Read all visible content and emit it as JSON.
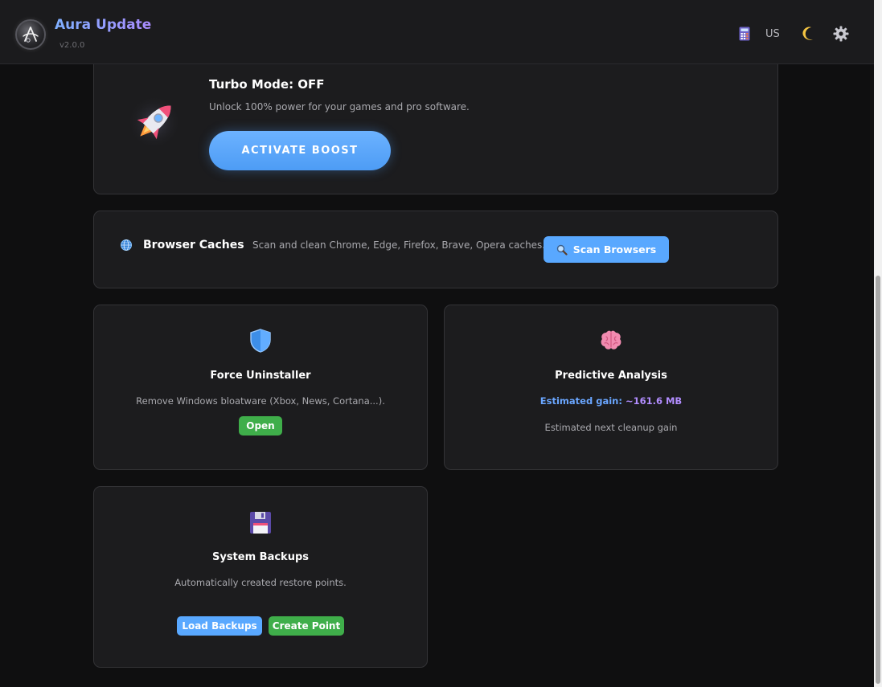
{
  "header": {
    "title": "Aura Update",
    "version": "v2.0.0",
    "language": "US",
    "icons": [
      "calculator-icon",
      "moon-icon",
      "gear-icon"
    ]
  },
  "turbo": {
    "title": "Turbo Mode: OFF",
    "description": "Unlock 100% power for your games and pro software.",
    "button_label": "ACTIVATE BOOST",
    "icon": "rocket-icon"
  },
  "browser": {
    "title": "Browser Caches",
    "description": "Scan and clean Chrome, Edge, Firefox, Brave, Opera caches.",
    "button_label": "Scan Browsers",
    "icon": "globe-icon"
  },
  "force": {
    "title": "Force Uninstaller",
    "description": "Remove Windows bloatware (Xbox, News, Cortana...).",
    "button_label": "Open",
    "icon": "shield-icon"
  },
  "predict": {
    "title": "Predictive Analysis",
    "gain_label": "Estimated gain:",
    "gain_value": "~161.6 MB",
    "subtitle": "Estimated next cleanup gain",
    "icon": "brain-icon"
  },
  "backup": {
    "title": "System Backups",
    "description": "Automatically created restore points.",
    "load_label": "Load Backups",
    "create_label": "Create Point",
    "icon": "floppy-disk-icon"
  },
  "colors": {
    "accent_blue": "#59a8ff",
    "accent_green": "#3fae4a",
    "accent_purple": "#b28dff",
    "background": "#0f0f10",
    "card": "#1c1c1e"
  }
}
